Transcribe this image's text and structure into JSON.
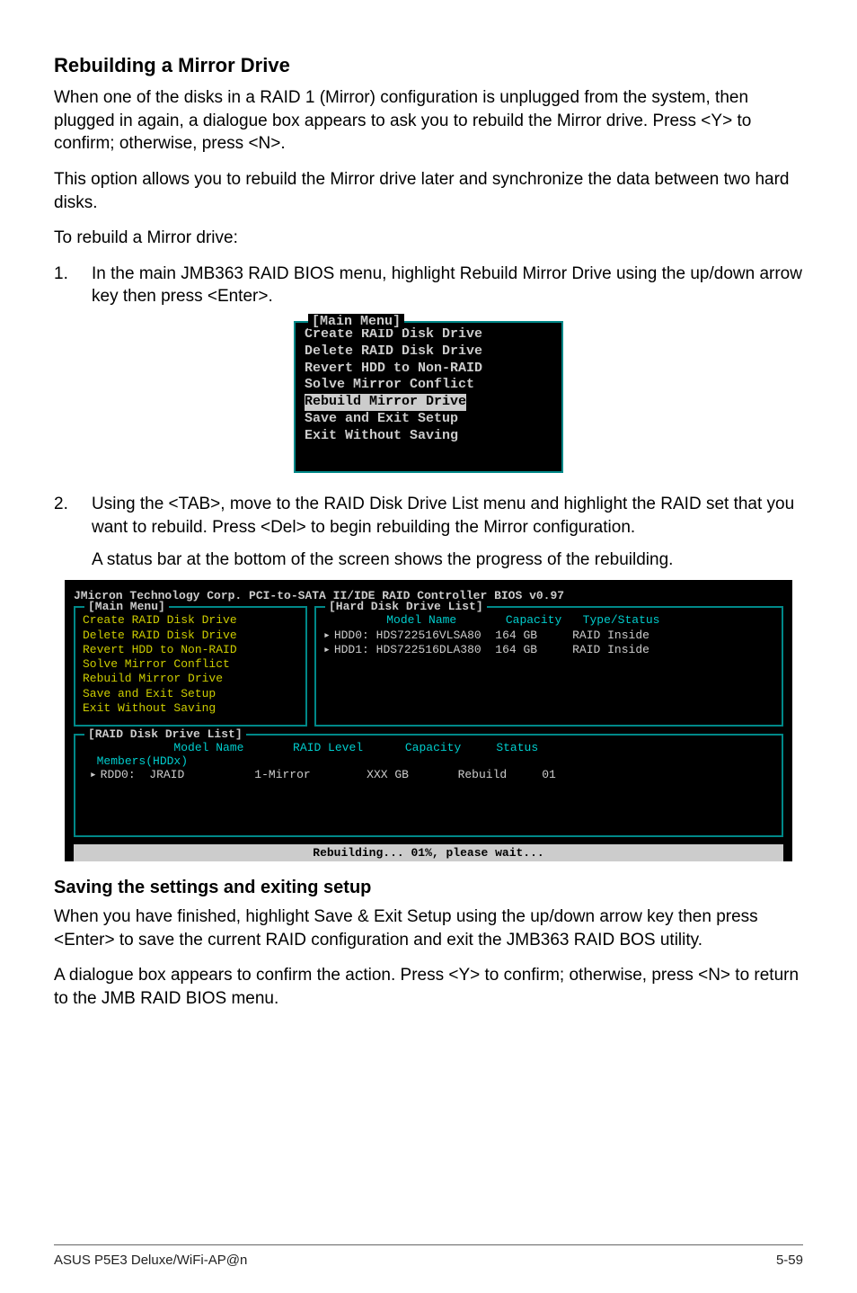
{
  "section1": {
    "title": "Rebuilding a Mirror Drive",
    "p1": "When one of the disks in a RAID 1 (Mirror) configuration is unplugged from the system, then plugged in again, a dialogue box appears to ask you to rebuild the Mirror drive. Press <Y> to confirm; otherwise, press <N>.",
    "p2": "This option allows you to rebuild the Mirror drive later and synchronize the data between two hard disks.",
    "p3": "To rebuild a Mirror drive:",
    "step1_num": "1.",
    "step1": "In the main JMB363 RAID BIOS menu, highlight Rebuild Mirror Drive using the up/down arrow key then press <Enter>.",
    "step2_num": "2.",
    "step2": "Using the <TAB>, move to the RAID Disk Drive List menu and highlight the RAID set that you want to rebuild. Press <Del> to begin rebuilding the Mirror configuration.",
    "step2_sub": "A status bar at the bottom of the screen shows the progress of the rebuilding."
  },
  "bios_small": {
    "label": "[Main Menu]",
    "items": [
      "Create RAID Disk Drive",
      "Delete RAID Disk Drive",
      "Revert HDD to Non-RAID",
      "Solve Mirror Conflict",
      "Rebuild Mirror Drive",
      "Save and Exit Setup",
      "Exit Without Saving"
    ],
    "highlight_index": 4
  },
  "bios_full": {
    "header": "JMicron Technology Corp. PCI-to-SATA II/IDE RAID Controller BIOS v0.97",
    "main_label": "[Main Menu]",
    "main_items": [
      "Create RAID Disk Drive",
      "Delete RAID Disk Drive",
      "Revert HDD to Non-RAID",
      "Solve Mirror Conflict",
      "Rebuild Mirror Drive",
      "Save and Exit Setup",
      "Exit Without Saving"
    ],
    "hdd_label": "[Hard Disk Drive List]",
    "hdd_header": {
      "c1": "Model Name",
      "c2": "Capacity",
      "c3": "Type/Status"
    },
    "hdd_rows": [
      {
        "id": "HDD0:",
        "model": "HDS722516VLSA80",
        "cap": "164 GB",
        "type": "RAID Inside"
      },
      {
        "id": "HDD1:",
        "model": "HDS722516DLA380",
        "cap": "164 GB",
        "type": "RAID Inside"
      }
    ],
    "raid_label": "[RAID Disk Drive List]",
    "raid_header": {
      "c1": "Model Name",
      "c2": "RAID Level",
      "c3": "Capacity",
      "c4": "Status"
    },
    "raid_members": "Members(HDDx)",
    "raid_rows": [
      {
        "id": "RDD0:",
        "name": "JRAID",
        "level": "1-Mirror",
        "cap": "XXX GB",
        "status": "Rebuild",
        "members": "01"
      }
    ],
    "status": "Rebuilding... 01%, please wait..."
  },
  "section2": {
    "title": "Saving the settings and exiting setup",
    "p1": "When you have finished, highlight Save & Exit Setup using the up/down arrow key then press <Enter> to save the current RAID configuration and exit the JMB363 RAID BOS utility.",
    "p2": "A dialogue box appears to confirm the action. Press <Y> to confirm; otherwise, press <N> to return to the JMB RAID BIOS menu."
  },
  "footer": {
    "left": "ASUS P5E3 Deluxe/WiFi-AP@n",
    "right": "5-59"
  }
}
